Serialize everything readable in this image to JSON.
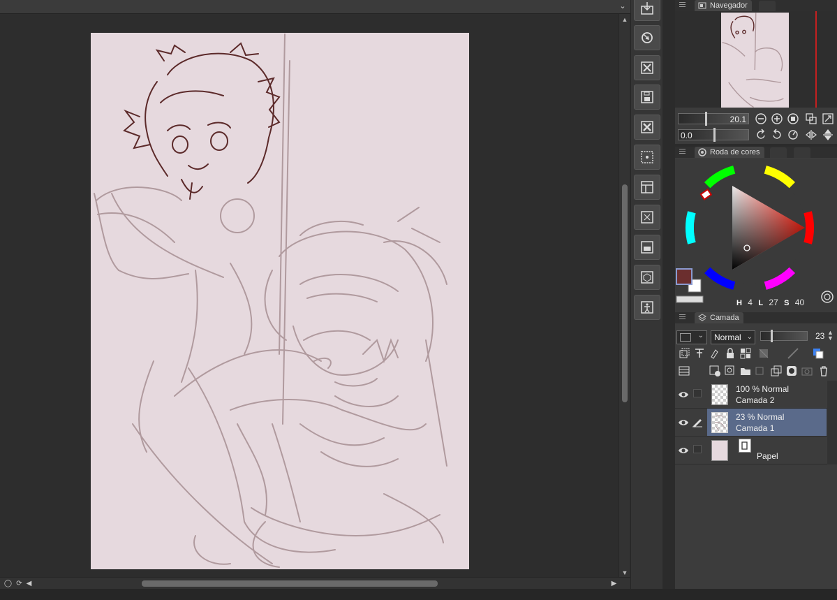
{
  "navigator": {
    "tab_label": "Navegador",
    "zoom": "20.1",
    "rotation": "0.0"
  },
  "color_wheel": {
    "tab_label": "Roda de cores",
    "hsv": {
      "h_label": "H",
      "h": "4",
      "l_label": "L",
      "l": "27",
      "s_label": "S",
      "s": "40"
    },
    "main_color": "#6b2e2e",
    "sub_color": "#ffffff"
  },
  "layers_panel": {
    "tab_label": "Camada",
    "blend_mode": "Normal",
    "opacity": "23",
    "layers": [
      {
        "mode": "100 % Normal",
        "name": "Camada 2"
      },
      {
        "mode": "23 % Normal",
        "name": "Camada 1"
      },
      {
        "mode": "",
        "name": "Papel"
      }
    ]
  },
  "colors": {
    "paper": "#e6d9de",
    "sketch": "#b09a9e",
    "ink": "#5c2a2a",
    "selection": "#5a6a8a",
    "navigator_marker": "#c42020"
  },
  "command_bar_icons": [
    "import-icon",
    "target-icon",
    "close-file-icon",
    "save-icon",
    "close-icon",
    "grid-icon",
    "frame-icon",
    "transform-icon",
    "image-icon",
    "cube-icon",
    "pose-icon"
  ]
}
